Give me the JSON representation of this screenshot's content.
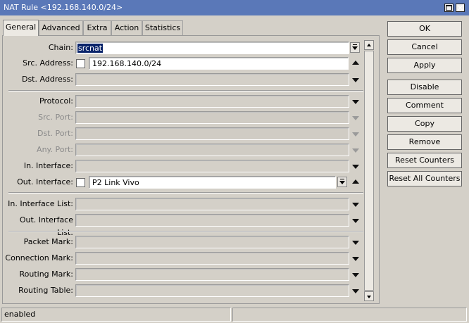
{
  "window": {
    "title": "NAT Rule <192.168.140.0/24>"
  },
  "tabs": [
    "General",
    "Advanced",
    "Extra",
    "Action",
    "Statistics"
  ],
  "fields": {
    "chain": {
      "label": "Chain:",
      "value": "srcnat"
    },
    "src_address": {
      "label": "Src. Address:",
      "value": "192.168.140.0/24"
    },
    "dst_address": {
      "label": "Dst. Address:"
    },
    "protocol": {
      "label": "Protocol:"
    },
    "src_port": {
      "label": "Src. Port:"
    },
    "dst_port": {
      "label": "Dst. Port:"
    },
    "any_port": {
      "label": "Any. Port:"
    },
    "in_interface": {
      "label": "In. Interface:"
    },
    "out_interface": {
      "label": "Out. Interface:",
      "value": "P2 Link Vivo"
    },
    "in_interface_list": {
      "label": "In. Interface List:"
    },
    "out_interface_list": {
      "label": "Out. Interface List:"
    },
    "packet_mark": {
      "label": "Packet Mark:"
    },
    "connection_mark": {
      "label": "Connection Mark:"
    },
    "routing_mark": {
      "label": "Routing Mark:"
    },
    "routing_table": {
      "label": "Routing Table:"
    }
  },
  "buttons": {
    "ok": "OK",
    "cancel": "Cancel",
    "apply": "Apply",
    "disable": "Disable",
    "comment": "Comment",
    "copy": "Copy",
    "remove": "Remove",
    "reset_counters": "Reset Counters",
    "reset_all_counters": "Reset All Counters"
  },
  "status": {
    "text": "enabled"
  },
  "colors": {
    "titlebar": "#5a78b8",
    "background": "#d4d0c8",
    "selection": "#0a246a"
  }
}
